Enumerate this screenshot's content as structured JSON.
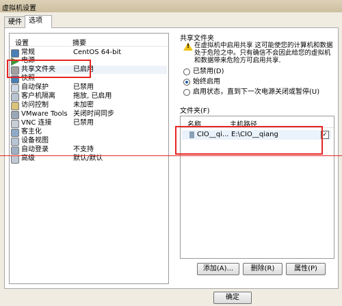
{
  "window": {
    "title": "虚拟机设置"
  },
  "tabs": [
    {
      "label": "硬件"
    },
    {
      "label": "选项"
    }
  ],
  "settings": {
    "header": {
      "col1": "设置",
      "col2": "摘要"
    },
    "items": [
      {
        "name": "常规",
        "value": "CentOS 64-bit",
        "icon": "monitor-icon",
        "color": "#4a7fb5"
      },
      {
        "name": "电源",
        "value": "",
        "icon": "power-play-icon",
        "color": "#3c9a3c"
      },
      {
        "name": "共享文件夹",
        "value": "已启用",
        "icon": "shared-folder-icon",
        "color": "#8a8a8a"
      },
      {
        "name": "快照",
        "value": "",
        "icon": "snapshot-icon",
        "color": "#4a7fb5"
      },
      {
        "name": "自动保护",
        "value": "已禁用",
        "icon": "autoprotect-icon",
        "color": "#777777"
      },
      {
        "name": "客户机隔离",
        "value": "拖放, 已启用",
        "icon": "isolation-icon",
        "color": "#777777"
      },
      {
        "name": "访问控制",
        "value": "未加密",
        "icon": "access-control-icon",
        "color": "#777777"
      },
      {
        "name": "VMware Tools",
        "value": "关闭时间同步",
        "icon": "vmware-tools-icon",
        "color": "#777777"
      },
      {
        "name": "VNC 连接",
        "value": "已禁用",
        "icon": "vnc-icon",
        "color": "#777777"
      },
      {
        "name": "客主化",
        "value": "",
        "icon": "unity-icon",
        "color": "#777777"
      },
      {
        "name": "设备视图",
        "value": "",
        "icon": "device-view-icon",
        "color": "#777777"
      },
      {
        "name": "自动登录",
        "value": "不支持",
        "icon": "autologin-icon",
        "color": "#777777"
      },
      {
        "name": "高级",
        "value": "默认/默认",
        "icon": "advanced-icon",
        "color": "#777777"
      }
    ]
  },
  "shared_folders": {
    "group_title": "共享文件夹",
    "warning": "在虚拟机中启用共享 这可能使您的计算机和数据处于危险之中。只有确信不会因此给您的虚拟机和数据带来危险方可启用共享.",
    "options": [
      {
        "label": "已禁用(D)",
        "selected": false
      },
      {
        "label": "始终启用",
        "selected": true
      },
      {
        "label": "启用状态，直到下一次电源关闭或暂停(U)",
        "selected": false
      }
    ],
    "folders_label": "文件夹(F)",
    "columns": {
      "name": "名称",
      "path": "主机路径"
    },
    "rows": [
      {
        "name": "CIO__qi...",
        "path": "E:\\CIO__qiang",
        "checked": true,
        "check_glyph": "✓"
      }
    ],
    "buttons": {
      "add": "添加(A)...",
      "remove": "删除(R)",
      "properties": "属性(P)"
    }
  },
  "footer": {
    "ok": "确定"
  },
  "accent": {
    "annotation": "#e52521"
  }
}
